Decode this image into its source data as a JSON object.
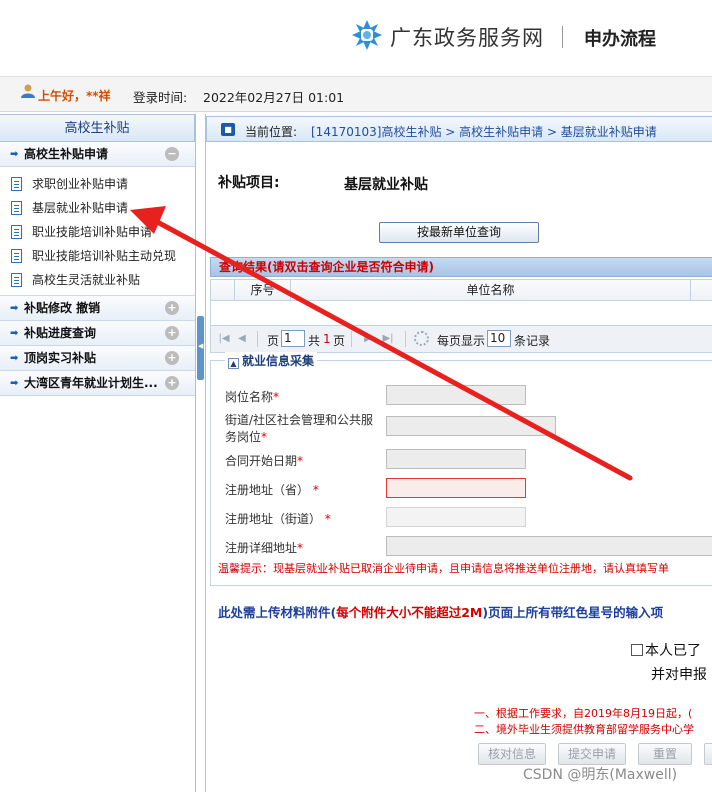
{
  "header": {
    "brand": "广东政务服务网",
    "flow": "申办流程"
  },
  "userbar": {
    "greeting": "上午好，**祥",
    "login_label": "登录时间:",
    "login_time": "2022年02月27日 01:01"
  },
  "sidebar": {
    "title": "高校生补贴",
    "groups": [
      {
        "label": "高校生补贴申请",
        "toggle": "−"
      },
      {
        "label": "补贴修改 撤销",
        "toggle": "+"
      },
      {
        "label": "补贴进度查询",
        "toggle": "+"
      },
      {
        "label": "顶岗实习补贴",
        "toggle": "+"
      },
      {
        "label": "大湾区青年就业计划生...",
        "toggle": "+"
      }
    ],
    "items": [
      "求职创业补贴申请",
      "基层就业补贴申请",
      "职业技能培训补贴申请",
      "职业技能培训补贴主动兑现",
      "高校生灵活就业补贴"
    ]
  },
  "breadcrumb": {
    "label": "当前位置:",
    "path": "[14170103]高校生补贴 > 高校生补贴申请 > 基层就业补贴申请"
  },
  "project": {
    "label": "补贴项目:",
    "value": "基层就业补贴"
  },
  "query_button": "按最新单位查询",
  "result": {
    "header": "查询结果(请双击查询企业是否符合申请)",
    "columns": [
      "序号",
      "单位名称"
    ]
  },
  "pager": {
    "page_label": "页",
    "page_value": "1",
    "total_prefix": "共",
    "total_pages": "1",
    "total_suffix": "页",
    "per_page_label": "每页显示",
    "per_page_value": "10",
    "records_label": "条记录"
  },
  "form": {
    "legend": "就业信息采集",
    "fields": [
      {
        "label": "岗位名称",
        "star": "*"
      },
      {
        "label": "街道/社区社会管理和公共服",
        "label2": "务岗位",
        "star": "*"
      },
      {
        "label": "合同开始日期",
        "star": "*"
      },
      {
        "label": "注册地址（省）",
        "star": "*"
      },
      {
        "label": "注册地址（街道）",
        "star": "*"
      },
      {
        "label": "注册详细地址",
        "star": "*"
      }
    ],
    "tip": "温馨提示：现基层就业补贴已取消企业待申请，且申请信息将推送单位注册地，请认真填写单"
  },
  "upload": {
    "prefix": "此处需上传材料附件(",
    "red": "每个附件大小不能超过2M",
    "suffix": ")页面上所有带红色星号的输入项"
  },
  "agreement": {
    "line1": "本人已了",
    "line2": "并对申报"
  },
  "notices": [
    "一、根据工作要求，自2019年8月19日起，(",
    "二、境外毕业生须提供教育部留学服务中心学"
  ],
  "actions": [
    "核对信息",
    "提交申请",
    "重置"
  ],
  "watermark": "CSDN @明东(Maxwell)",
  "colors": {
    "accent": "#1f4e9c",
    "warning": "#d40000",
    "arrow": "#e8201e"
  }
}
